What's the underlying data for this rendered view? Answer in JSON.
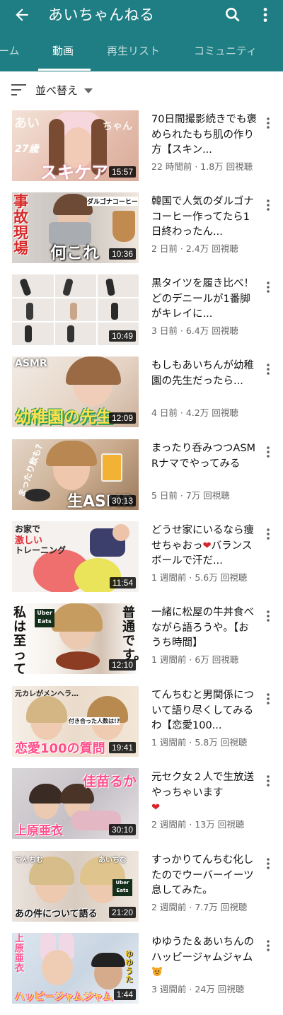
{
  "header": {
    "title": "あいちゃんねる",
    "back_icon": "arrow-back-icon",
    "search_icon": "search-icon",
    "more_icon": "more-vert-icon",
    "bar_color": "#1f7e83"
  },
  "tabs": [
    {
      "label": "ーム",
      "active": false
    },
    {
      "label": "動画",
      "active": true
    },
    {
      "label": "再生リスト",
      "active": false
    },
    {
      "label": "コミュニティ",
      "active": false
    }
  ],
  "sort": {
    "label": "並べ替え",
    "icon": "sort-icon"
  },
  "videos": [
    {
      "title": "70日間撮影続きでも褒められたもち肌の作り方【スキン...",
      "meta": "22 時間前 · 1.8万 回視聴",
      "duration": "15:57",
      "thumb_text": [
        "あい",
        "ちゃん",
        "27歳",
        "スキケア"
      ]
    },
    {
      "title": "韓国で人気のダルゴナコーヒー作ってたら1日終わったん...",
      "meta": "2 日前 · 2.4万 回視聴",
      "duration": "10:36",
      "thumb_text": [
        "事故現場",
        "ダルゴナコーヒー",
        "何これ"
      ]
    },
    {
      "title": "黒タイツを履き比べ！どのデニールが1番脚がキレイに...",
      "meta": "3 日前 · 6.4万 回視聴",
      "duration": "10:49",
      "thumb_text": []
    },
    {
      "title": "もしもあいちんが幼稚園の先生だったら...",
      "meta": "4 日前 · 4.2万 回視聴",
      "duration": "12:09",
      "thumb_text": [
        "ASMR",
        "幼稚園の先生"
      ]
    },
    {
      "title": "まったり呑みつつASMRナマでやってみる",
      "meta": "5 日前 · 7万 回視聴",
      "duration": "30:13",
      "thumb_text": [
        "まったり飲も?",
        "生ASMR"
      ]
    },
    {
      "title": "どうせ家にいるなら痩せちゃおっ",
      "title_tail": "バランスボールで汗だ...",
      "meta": "1 週間前 · 5.6万 回視聴",
      "duration": "11:54",
      "thumb_text": [
        "お家で",
        "激しい",
        "トレーニング"
      ]
    },
    {
      "title": "一緒に松屋の牛丼食べながら語ろうや。【おうち時間】",
      "meta": "1 週間前 · 6万 回視聴",
      "duration": "12:10",
      "thumb_text": [
        "私は至って",
        "普通です。",
        "Uber Eats"
      ]
    },
    {
      "title": "てんちむと男関係について語り尽くしてみるわ【恋愛100...",
      "meta": "1 週間前 · 5.8万 回視聴",
      "duration": "19:41",
      "thumb_text": [
        "元カレがメンヘラ…",
        "付き合った人数は!?",
        "恋愛100の質問"
      ]
    },
    {
      "title": "元セク女２人で生放送やっちゃいます",
      "meta": "2 週間前 · 13万 回視聴",
      "duration": "30:10",
      "thumb_text": [
        "佳苗るか",
        "上原亜衣"
      ]
    },
    {
      "title": "すっかりてんちむ化したのでウーバーイーツ息してみた。",
      "meta": "2 週間前 · 7.7万 回視聴",
      "duration": "21:20",
      "thumb_text": [
        "てんちむ",
        "あいちむ",
        "Uber Eats",
        "あの件について語る"
      ]
    },
    {
      "title": "ゆゆうた＆あいちんのハッピージャムジャム",
      "meta": "3 週間前 · 24万 回視聴",
      "duration": "1:44",
      "thumb_text": [
        "上原亜衣",
        "ゆゆうた",
        "ハッピージャムジャム"
      ]
    }
  ]
}
